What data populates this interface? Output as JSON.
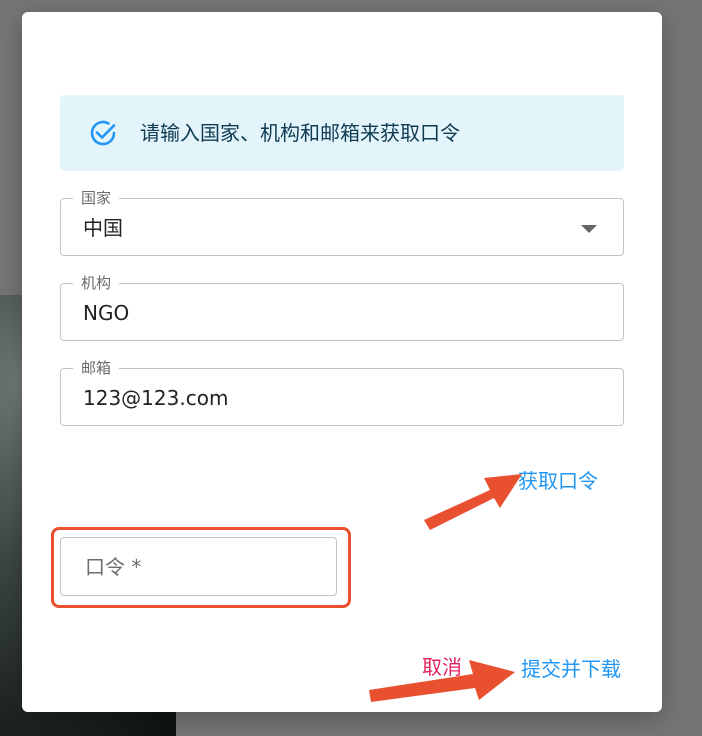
{
  "alert": {
    "icon": "check-circle-icon",
    "text": "请输入国家、机构和邮箱来获取口令"
  },
  "fields": {
    "country": {
      "label": "国家",
      "value": "中国"
    },
    "organization": {
      "label": "机构",
      "value": "NGO"
    },
    "email": {
      "label": "邮箱",
      "value": "123@123.com"
    }
  },
  "get_passcode_label": "获取口令",
  "passcode": {
    "placeholder": "口令 *",
    "value": ""
  },
  "actions": {
    "cancel_label": "取消",
    "submit_label": "提交并下载"
  },
  "colors": {
    "primary": "#2196f3",
    "cancel": "#e0245e",
    "annotation": "#e8502f",
    "alert_bg": "#e3f4fb"
  }
}
